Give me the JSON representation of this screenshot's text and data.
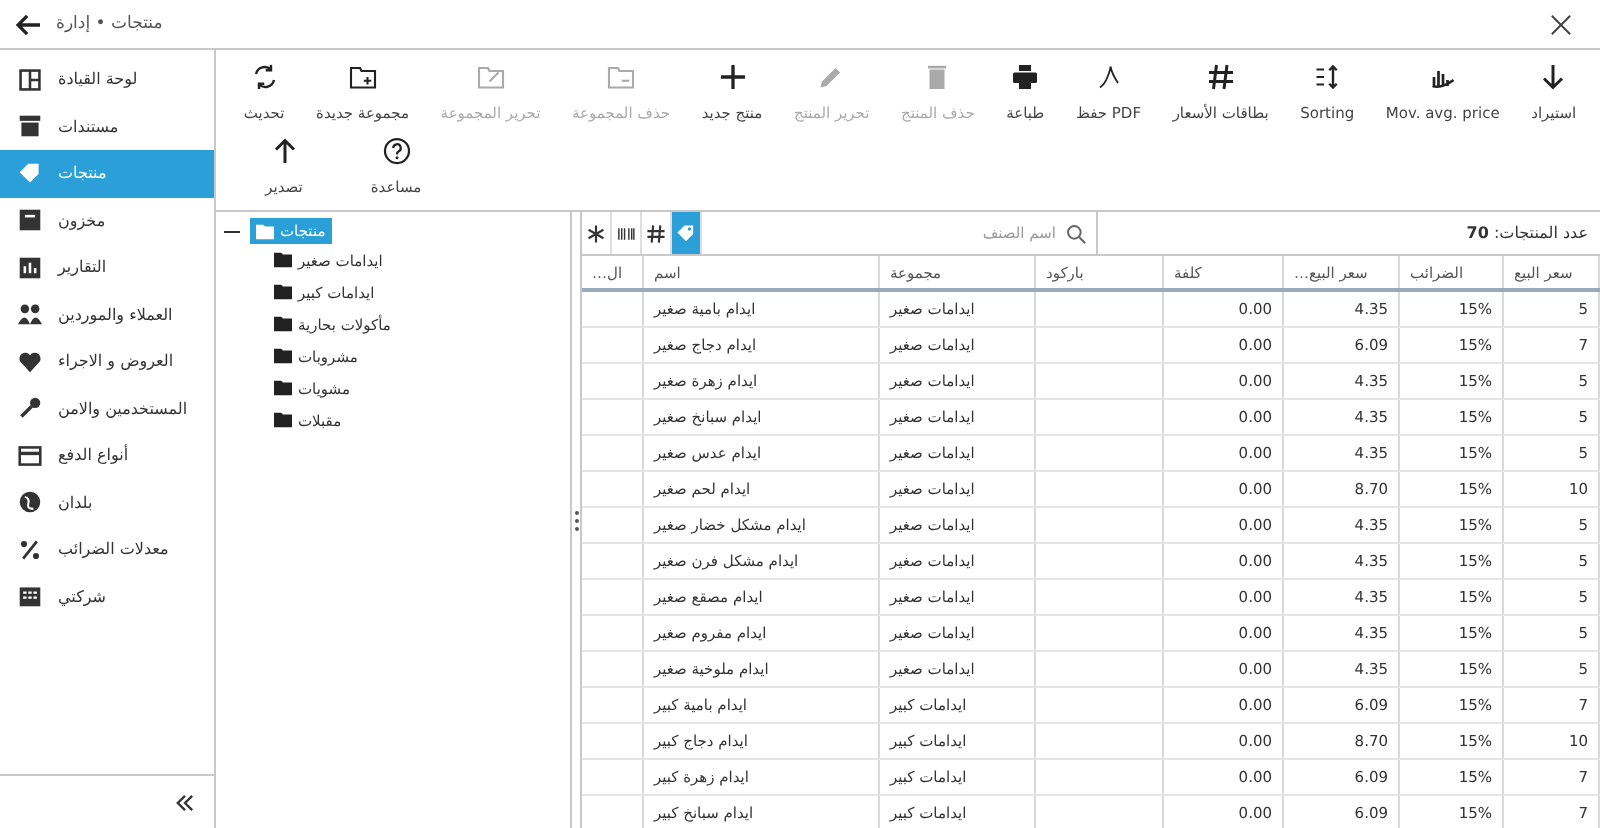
{
  "window": {
    "title": "منتجات • إدارة"
  },
  "sidebar": {
    "items": [
      {
        "label": "لوحة القيادة",
        "selected": false
      },
      {
        "label": "مستندات",
        "selected": false
      },
      {
        "label": "منتجات",
        "selected": true
      },
      {
        "label": "مخزون",
        "selected": false
      },
      {
        "label": "التقارير",
        "selected": false
      },
      {
        "label": "العملاء والموردين",
        "selected": false
      },
      {
        "label": "العروض و الاجراء",
        "selected": false
      },
      {
        "label": "المستخدمين والامن",
        "selected": false
      },
      {
        "label": "أنواع الدفع",
        "selected": false
      },
      {
        "label": "بلدان",
        "selected": false
      },
      {
        "label": "معدلات الضرائب",
        "selected": false
      },
      {
        "label": "شركتي",
        "selected": false
      }
    ]
  },
  "toolbar": [
    [
      {
        "label": "استيراد",
        "disabled": false
      },
      {
        "label": "Mov. avg. price",
        "disabled": false
      },
      {
        "label": "Sorting",
        "disabled": false
      },
      {
        "label": "بطاقات الأسعار",
        "disabled": false
      },
      {
        "label": "حفظ PDF",
        "disabled": false
      },
      {
        "label": "طباعة",
        "disabled": false
      },
      {
        "label": "حذف المنتج",
        "disabled": true
      },
      {
        "label": "تحرير المنتج",
        "disabled": true
      },
      {
        "label": "منتج جديد",
        "disabled": false
      },
      {
        "label": "حذف المجموعة",
        "disabled": true
      },
      {
        "label": "تحرير المجموعة",
        "disabled": true
      },
      {
        "label": "مجموعة جديدة",
        "disabled": false
      },
      {
        "label": "تحديث",
        "disabled": false
      }
    ],
    [
      {
        "label": "مساعدة",
        "disabled": false
      },
      {
        "label": "تصدير",
        "disabled": false
      }
    ]
  ],
  "tree": {
    "label": "منتجات",
    "expanded": true,
    "selected": true,
    "children": [
      {
        "label": "ايدامات صغير"
      },
      {
        "label": "ايدامات كبير"
      },
      {
        "label": "مأكولات بحارية"
      },
      {
        "label": "مشروبات"
      },
      {
        "label": "مشويات"
      },
      {
        "label": "مقبلات"
      }
    ]
  },
  "view_buttons": [
    {
      "selected": false
    },
    {
      "selected": false
    },
    {
      "selected": false
    },
    {
      "selected": true
    }
  ],
  "search": {
    "placeholder": "اسم الصنف"
  },
  "product_count": "عدد المنتجات: **70**",
  "table": {
    "columns": [
      "سعر البيع",
      "الضرائب",
      "سعر البيع…",
      "كلفة",
      "باركود",
      "مجموعة",
      "اسم",
      "ال…"
    ],
    "rows": [
      [
        "5",
        "15%",
        "4.35",
        "0.00",
        "",
        "ايدامات صغير",
        "ايدام بامية صغير",
        ""
      ],
      [
        "7",
        "15%",
        "6.09",
        "0.00",
        "",
        "ايدامات صغير",
        "ايدام دجاج صغير",
        ""
      ],
      [
        "5",
        "15%",
        "4.35",
        "0.00",
        "",
        "ايدامات صغير",
        "ايدام زهرة صغير",
        ""
      ],
      [
        "5",
        "15%",
        "4.35",
        "0.00",
        "",
        "ايدامات صغير",
        "ايدام سبانخ صغير",
        ""
      ],
      [
        "5",
        "15%",
        "4.35",
        "0.00",
        "",
        "ايدامات صغير",
        "ايدام عدس صغير",
        ""
      ],
      [
        "10",
        "15%",
        "8.70",
        "0.00",
        "",
        "ايدامات صغير",
        "ايدام لحم صغير",
        ""
      ],
      [
        "5",
        "15%",
        "4.35",
        "0.00",
        "",
        "ايدامات صغير",
        "ايدام مشكل خضار صغير",
        ""
      ],
      [
        "5",
        "15%",
        "4.35",
        "0.00",
        "",
        "ايدامات صغير",
        "ايدام مشكل فرن صغير",
        ""
      ],
      [
        "5",
        "15%",
        "4.35",
        "0.00",
        "",
        "ايدامات صغير",
        "ايدام مصقع صغير",
        ""
      ],
      [
        "5",
        "15%",
        "4.35",
        "0.00",
        "",
        "ايدامات صغير",
        "ايدام مفروم صغير",
        ""
      ],
      [
        "5",
        "15%",
        "4.35",
        "0.00",
        "",
        "ايدامات صغير",
        "ايدام ملوخية صغير",
        ""
      ],
      [
        "7",
        "15%",
        "6.09",
        "0.00",
        "",
        "ايدامات كبير",
        "ايدام بامية كبير",
        ""
      ],
      [
        "10",
        "15%",
        "8.70",
        "0.00",
        "",
        "ايدامات كبير",
        "ايدام دجاج كبير",
        ""
      ],
      [
        "7",
        "15%",
        "6.09",
        "0.00",
        "",
        "ايدامات كبير",
        "ايدام زهرة كبير",
        ""
      ],
      [
        "7",
        "15%",
        "6.09",
        "0.00",
        "",
        "ايدامات كبير",
        "ايدام سبانخ كبير",
        ""
      ]
    ]
  }
}
